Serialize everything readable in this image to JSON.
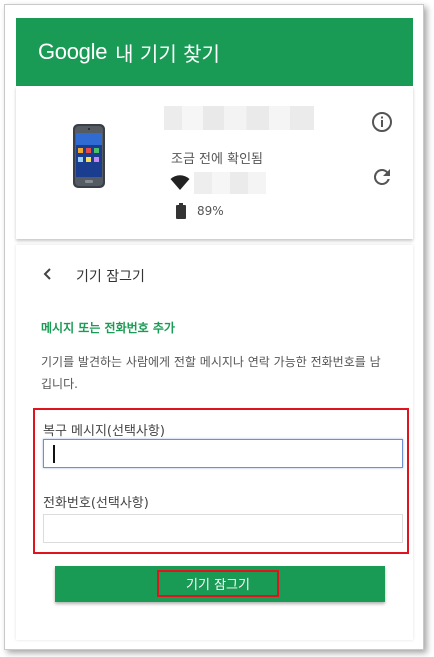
{
  "header": {
    "brand": "Google",
    "title": "내 기기 찾기",
    "background_color": "#1a9b55"
  },
  "device": {
    "last_seen": "조금 전에 확인됨",
    "battery": "89%",
    "icons": {
      "phone": "phone-image",
      "info": "info-icon",
      "refresh": "refresh-icon",
      "wifi": "wifi-icon",
      "battery": "battery-icon"
    }
  },
  "lock_panel": {
    "back_icon": "chevron-left-icon",
    "title": "기기 잠그기",
    "section_heading": "메시지 또는 전화번호 추가",
    "description": "기기를 발견하는 사람에게 전할 메시지나 연락 가능한 전화번호를 남깁니다.",
    "recovery_message_label": "복구 메시지(선택사항)",
    "recovery_message_value": "",
    "phone_label": "전화번호(선택사항)",
    "phone_value": "",
    "lock_button_label": "기기 잠그기",
    "accent_color": "#1a9b55",
    "highlight_color": "#e0141c"
  }
}
